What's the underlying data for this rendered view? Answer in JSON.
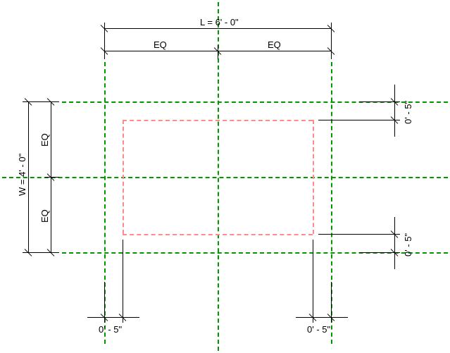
{
  "dims": {
    "L_label": "L = 6' - 0\"",
    "W_label": "W = 4' - 0\"",
    "eq": "EQ",
    "offset": "0' - 5\""
  }
}
